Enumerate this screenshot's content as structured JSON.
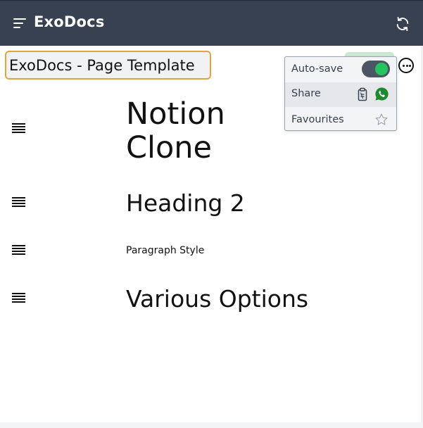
{
  "app": {
    "title": "ExoDocs"
  },
  "document": {
    "title_value": "ExoDocs - Page Template"
  },
  "menu": {
    "autosave_label": "Auto-save",
    "autosave_on": true,
    "share_label": "Share",
    "favourites_label": "Favourites"
  },
  "blocks": [
    {
      "type": "heading1",
      "text": "Notion Clone"
    },
    {
      "type": "heading2",
      "text": "Heading 2"
    },
    {
      "type": "paragraph",
      "text": "Paragraph Style"
    },
    {
      "type": "heading2",
      "text": "Various Options"
    }
  ],
  "icons": {
    "menu": "hamburger-icon",
    "sync": "sync-icon",
    "more": "more-options-icon",
    "copy": "clipboard-icon",
    "whatsapp": "whatsapp-icon",
    "favourite": "star-icon",
    "handle": "drag-handle-icon"
  },
  "colors": {
    "topbar": "#374151",
    "input_border": "#e6a23c",
    "toggle_on": "#22c55e",
    "whatsapp": "#1e8a2f"
  }
}
